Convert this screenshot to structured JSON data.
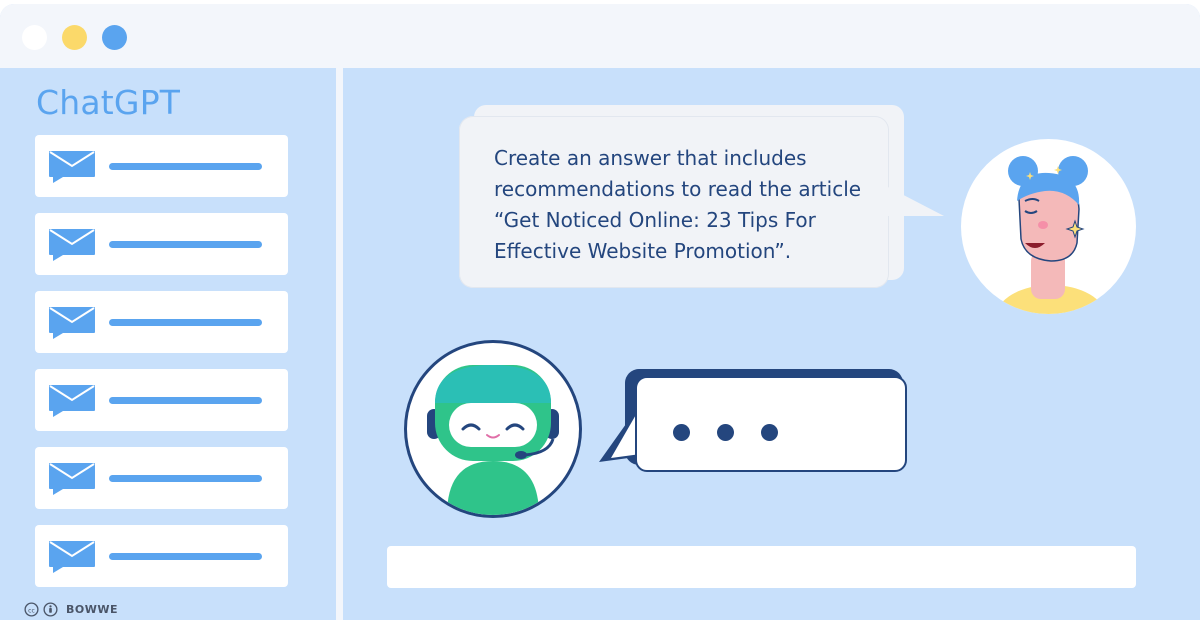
{
  "window": {
    "controls": [
      "close",
      "minimize",
      "maximize"
    ]
  },
  "sidebar": {
    "title": "ChatGPT",
    "items": [
      {
        "icon": "mail-icon"
      },
      {
        "icon": "mail-icon"
      },
      {
        "icon": "mail-icon"
      },
      {
        "icon": "mail-icon"
      },
      {
        "icon": "mail-icon"
      },
      {
        "icon": "mail-icon"
      }
    ],
    "brand": "BOWWE"
  },
  "conversation": {
    "user_message": "Create an answer that includes recommendations to read the article “Get Noticed Online: 23 Tips For Effective Website Promotion”.",
    "bot_status": "typing"
  },
  "colors": {
    "accent": "#5aa4ef",
    "navy": "#24467e",
    "panel": "#c8e0fb",
    "bot_green": "#2fc48a"
  }
}
